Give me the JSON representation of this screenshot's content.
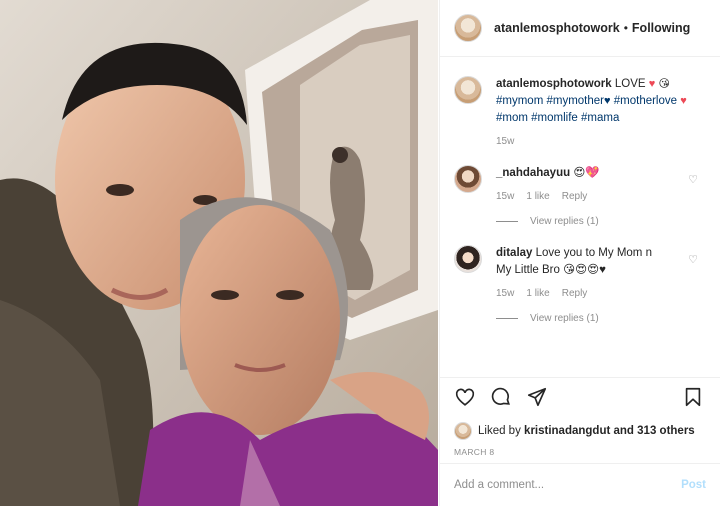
{
  "post": {
    "username": "atanlemosphotowork",
    "follow_status": "Following",
    "separator": "•"
  },
  "caption": {
    "username": "atanlemosphotowork",
    "text_lead": "LOVE",
    "emoji_1": "♥",
    "emoji_2": "😘",
    "tag_mymom": "#mymom",
    "tag_mymother": "#mymother",
    "emoji_3": "♥",
    "tag_motherlove": "#motherlove",
    "emoji_4": "♥",
    "tag_mom": "#mom",
    "tag_momlife": "#momlife",
    "tag_mama": "#mama",
    "age": "15w"
  },
  "comments": [
    {
      "username": "_nahdahayuu",
      "text": "😍💖",
      "age": "15w",
      "likes": "1 like",
      "reply": "Reply",
      "view_replies": "View replies (1)"
    },
    {
      "username": "ditalay",
      "text": "Love you to My Mom n My Little Bro 😘😍😍♥",
      "age": "15w",
      "likes": "1 like",
      "reply": "Reply",
      "view_replies": "View replies (1)"
    }
  ],
  "likes": {
    "prefix": "Liked by",
    "user": "kristinadangdut",
    "suffix": "and 313 others"
  },
  "date": "MARCH 8",
  "add_comment": {
    "placeholder": "Add a comment...",
    "post_label": "Post"
  },
  "colors": {
    "hashtag": "#00376b",
    "heart": "#ed4956",
    "muted": "#8e8e8e",
    "post_disabled": "#b2dffc"
  },
  "icons": [
    "heart-icon",
    "comment-icon",
    "share-icon",
    "bookmark-icon"
  ]
}
